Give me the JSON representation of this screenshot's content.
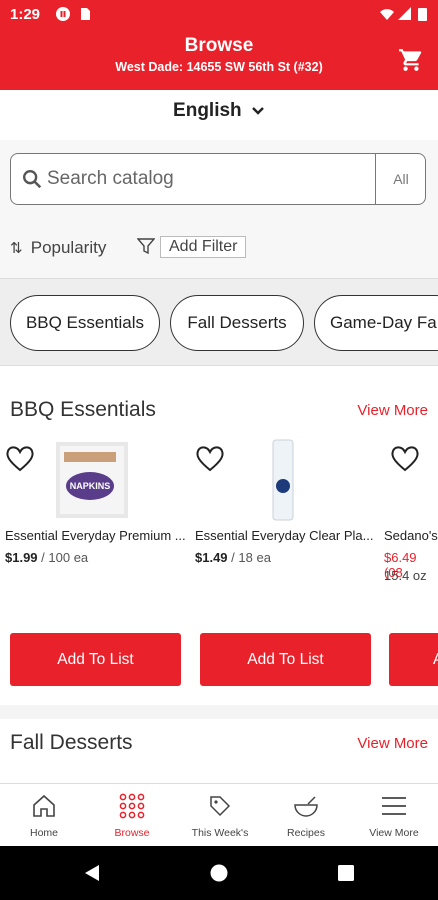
{
  "status_bar": {
    "time": "1:29"
  },
  "header": {
    "title": "Browse",
    "subtitle": "West Dade: 14655 SW 56th St (#32)"
  },
  "language": {
    "label": "English"
  },
  "search": {
    "placeholder": "Search catalog",
    "scope_label": "All"
  },
  "sort": {
    "label": "Popularity"
  },
  "filter": {
    "label": "Add Filter"
  },
  "chips": [
    "BBQ Essentials",
    "Fall Desserts",
    "Game-Day Fa"
  ],
  "sections": [
    {
      "title": "BBQ Essentials",
      "view_more": "View More",
      "products": [
        {
          "name": "Essential Everyday Premium ...",
          "price": "$1.99",
          "unit": "/ 100 ea",
          "size": "",
          "add_label": "Add To List"
        },
        {
          "name": "Essential Everyday Clear Pla...",
          "price": "$1.49",
          "unit": "/ 18 ea",
          "size": "",
          "add_label": "Add To List"
        },
        {
          "name": "Sedano's",
          "price": "$6.49 (08",
          "unit": "",
          "size": "15.4 oz",
          "add_label": "A"
        }
      ]
    },
    {
      "title": "Fall Desserts",
      "view_more": "View More"
    }
  ],
  "bottom_nav": [
    {
      "label": "Home",
      "icon": "home-icon"
    },
    {
      "label": "Browse",
      "icon": "grid-dots-icon"
    },
    {
      "label": "This Week's",
      "icon": "tag-icon"
    },
    {
      "label": "Recipes",
      "icon": "bowl-icon"
    },
    {
      "label": "View More",
      "icon": "menu-icon"
    }
  ],
  "colors": {
    "brand_red": "#e8212b"
  }
}
